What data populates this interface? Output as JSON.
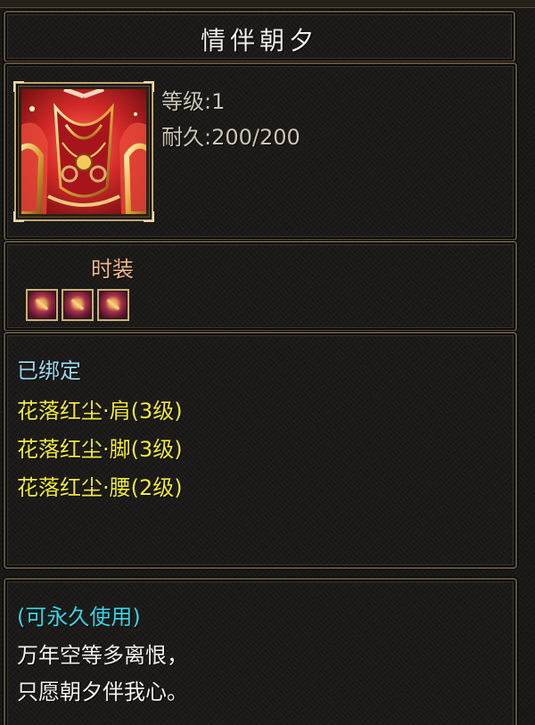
{
  "item": {
    "name": "情伴朝夕",
    "level_text": "等级:1",
    "durability_text": "耐久:200/200",
    "category": "时装",
    "set_pieces": 3,
    "icon": "red-robe-icon"
  },
  "attributes": {
    "bound": "已绑定",
    "lines": [
      "花落红尘·肩(3级)",
      "花落红尘·脚(3级)",
      "花落红尘·腰(2级)"
    ]
  },
  "description": {
    "usage": "(可永久使用)",
    "lines": [
      "万年空等多离恨，",
      "只愿朝夕伴我心。"
    ]
  },
  "colors": {
    "title": "#f2f0e8",
    "stat": "#cdc5b4",
    "category": "#f0b78a",
    "bound": "#9ad8f0",
    "set_attr": "#f3ea36",
    "usage": "#38d6ea",
    "poem": "#f3f2ee",
    "border": "#5e523d"
  }
}
